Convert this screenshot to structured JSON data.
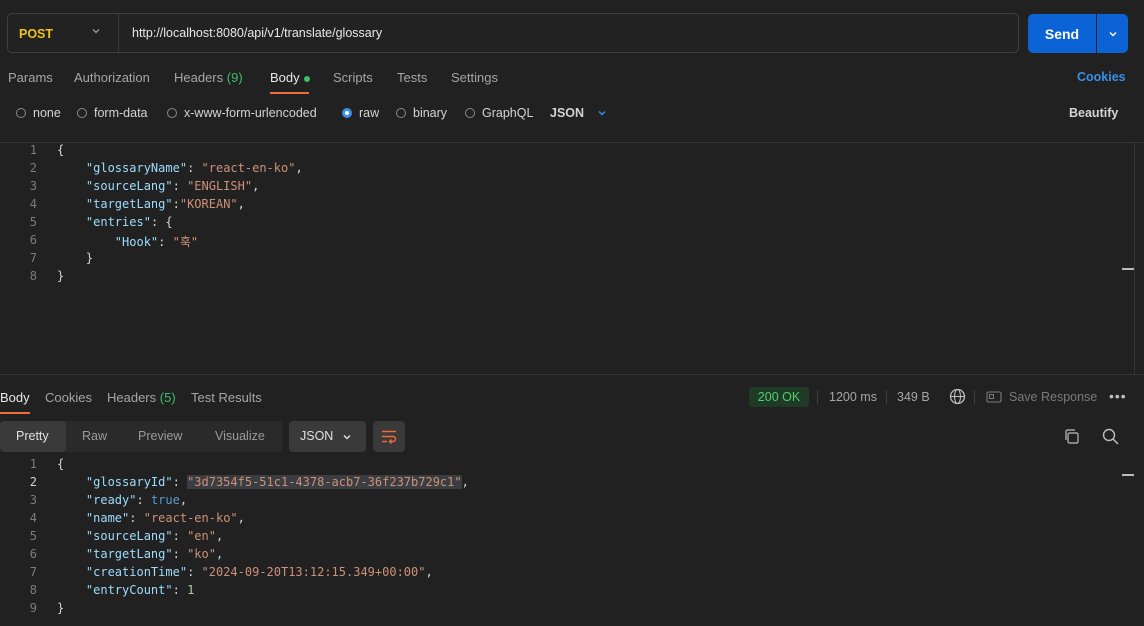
{
  "request": {
    "method": "POST",
    "url": "http://localhost:8080/api/v1/translate/glossary",
    "send_label": "Send"
  },
  "tabs": {
    "params": "Params",
    "authorization": "Authorization",
    "headers": "Headers",
    "headers_count": "(9)",
    "body": "Body",
    "scripts": "Scripts",
    "tests": "Tests",
    "settings": "Settings",
    "cookies": "Cookies"
  },
  "body_types": {
    "none": "none",
    "form_data": "form-data",
    "urlencoded": "x-www-form-urlencoded",
    "raw": "raw",
    "binary": "binary",
    "graphql": "GraphQL",
    "format": "JSON",
    "beautify": "Beautify"
  },
  "request_body_lines": [
    {
      "n": "1",
      "indent": "",
      "parts": [
        {
          "t": "p",
          "v": "{"
        }
      ]
    },
    {
      "n": "2",
      "indent": "    ",
      "parts": [
        {
          "t": "k",
          "v": "\"glossaryName\""
        },
        {
          "t": "p",
          "v": ": "
        },
        {
          "t": "s",
          "v": "\"react-en-ko\""
        },
        {
          "t": "p",
          "v": ","
        }
      ]
    },
    {
      "n": "3",
      "indent": "    ",
      "parts": [
        {
          "t": "k",
          "v": "\"sourceLang\""
        },
        {
          "t": "p",
          "v": ": "
        },
        {
          "t": "s",
          "v": "\"ENGLISH\""
        },
        {
          "t": "p",
          "v": ","
        }
      ]
    },
    {
      "n": "4",
      "indent": "    ",
      "parts": [
        {
          "t": "k",
          "v": "\"targetLang\""
        },
        {
          "t": "p",
          "v": ":"
        },
        {
          "t": "s",
          "v": "\"KOREAN\""
        },
        {
          "t": "p",
          "v": ","
        }
      ]
    },
    {
      "n": "5",
      "indent": "    ",
      "parts": [
        {
          "t": "k",
          "v": "\"entries\""
        },
        {
          "t": "p",
          "v": ": {"
        }
      ]
    },
    {
      "n": "6",
      "indent": "        ",
      "parts": [
        {
          "t": "k",
          "v": "\"Hook\""
        },
        {
          "t": "p",
          "v": ": "
        },
        {
          "t": "s",
          "v": "\"훅\""
        }
      ]
    },
    {
      "n": "7",
      "indent": "    ",
      "parts": [
        {
          "t": "p",
          "v": "}"
        }
      ]
    },
    {
      "n": "8",
      "indent": "",
      "parts": [
        {
          "t": "p",
          "v": "}"
        }
      ]
    }
  ],
  "response": {
    "tabs": {
      "body": "Body",
      "cookies": "Cookies",
      "headers": "Headers",
      "headers_count": "(5)",
      "test_results": "Test Results"
    },
    "status": "200 OK",
    "time": "1200 ms",
    "size": "349 B",
    "save_response": "Save Response",
    "views": {
      "pretty": "Pretty",
      "raw": "Raw",
      "preview": "Preview",
      "visualize": "Visualize"
    },
    "format": "JSON",
    "lines": [
      {
        "n": "1",
        "indent": "",
        "parts": [
          {
            "t": "p",
            "v": "{"
          }
        ]
      },
      {
        "n": "2",
        "indent": "    ",
        "parts": [
          {
            "t": "k",
            "v": "\"glossaryId\""
          },
          {
            "t": "p",
            "v": ": "
          },
          {
            "t": "sh",
            "v": "\"3d7354f5-51c1-4378-acb7-36f237b729c1\""
          },
          {
            "t": "p",
            "v": ","
          }
        ]
      },
      {
        "n": "3",
        "indent": "    ",
        "parts": [
          {
            "t": "k",
            "v": "\"ready\""
          },
          {
            "t": "p",
            "v": ": "
          },
          {
            "t": "b",
            "v": "true"
          },
          {
            "t": "p",
            "v": ","
          }
        ]
      },
      {
        "n": "4",
        "indent": "    ",
        "parts": [
          {
            "t": "k",
            "v": "\"name\""
          },
          {
            "t": "p",
            "v": ": "
          },
          {
            "t": "s",
            "v": "\"react-en-ko\""
          },
          {
            "t": "p",
            "v": ","
          }
        ]
      },
      {
        "n": "5",
        "indent": "    ",
        "parts": [
          {
            "t": "k",
            "v": "\"sourceLang\""
          },
          {
            "t": "p",
            "v": ": "
          },
          {
            "t": "s",
            "v": "\"en\""
          },
          {
            "t": "p",
            "v": ","
          }
        ]
      },
      {
        "n": "6",
        "indent": "    ",
        "parts": [
          {
            "t": "k",
            "v": "\"targetLang\""
          },
          {
            "t": "p",
            "v": ": "
          },
          {
            "t": "s",
            "v": "\"ko\""
          },
          {
            "t": "p",
            "v": ","
          }
        ]
      },
      {
        "n": "7",
        "indent": "    ",
        "parts": [
          {
            "t": "k",
            "v": "\"creationTime\""
          },
          {
            "t": "p",
            "v": ": "
          },
          {
            "t": "s",
            "v": "\"2024-09-20T13:12:15.349+00:00\""
          },
          {
            "t": "p",
            "v": ","
          }
        ]
      },
      {
        "n": "8",
        "indent": "    ",
        "parts": [
          {
            "t": "k",
            "v": "\"entryCount\""
          },
          {
            "t": "p",
            "v": ": "
          },
          {
            "t": "n",
            "v": "1"
          }
        ]
      },
      {
        "n": "9",
        "indent": "",
        "parts": [
          {
            "t": "p",
            "v": "}"
          }
        ]
      }
    ]
  },
  "colors": {
    "accent_tab": "#f26b3a",
    "send_button": "#0b63d6",
    "method_post": "#f0c419",
    "status_ok": "#4ccf6f",
    "link_blue": "#3b8fe8"
  }
}
